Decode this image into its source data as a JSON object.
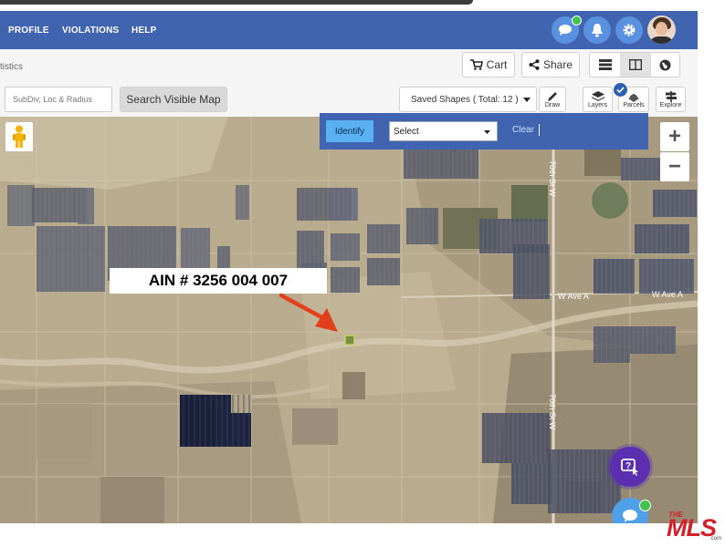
{
  "nav": {
    "profile": "PROFILE",
    "violations": "VIOLATIONS",
    "help": "HELP"
  },
  "breadcrumb": "tistics",
  "toolbar": {
    "cart": "Cart",
    "share": "Share",
    "search_placeholder": "SubDiv, Loc & Radius",
    "search_visible": "Search Visible Map",
    "saved_shapes": "Saved Shapes ( Total: 12 )",
    "draw": "Draw",
    "layers": "Layers",
    "parcels": "Parcels",
    "explore": "Explore"
  },
  "identify": {
    "button": "Identify",
    "select": "Select",
    "clear": "Clear"
  },
  "map": {
    "annotation": "AIN # 3256 004 007",
    "road_labels": [
      "70th St W",
      "W Ave A",
      "W Ave A",
      "70th St W"
    ]
  },
  "zoom": {
    "in": "+",
    "out": "−"
  },
  "watermark": {
    "the": "THE",
    "mls": "MLS",
    "com": ".com"
  },
  "colors": {
    "header": "#4064b0",
    "accent": "#5a90e0",
    "identify": "#5ab0f0",
    "arrow": "#e2401c",
    "mls_red": "#d4202a"
  }
}
